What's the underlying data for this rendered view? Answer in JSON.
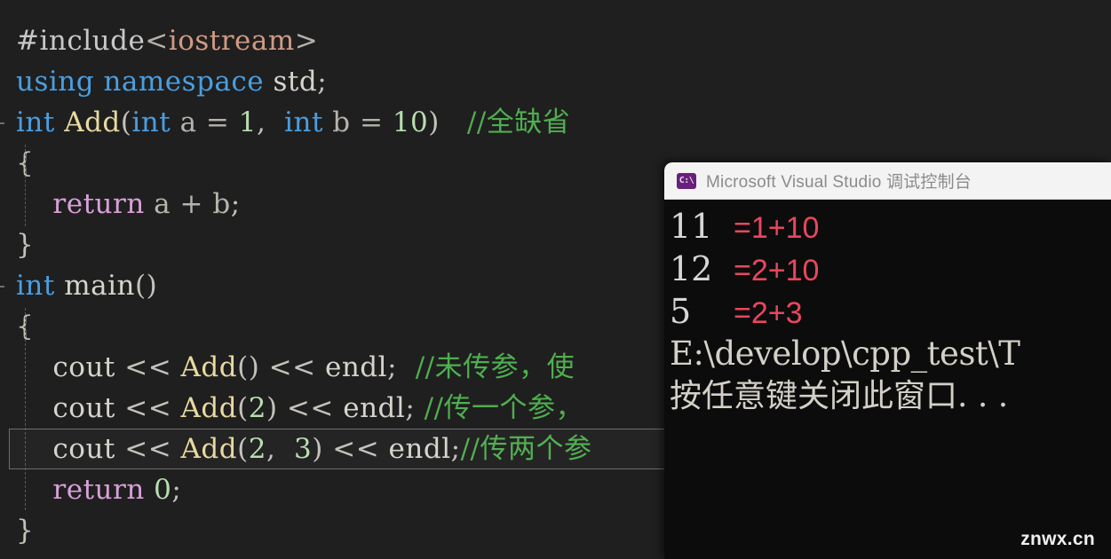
{
  "editor": {
    "background": "#1f1f1f",
    "lines": [
      {
        "indent": 0,
        "tokens": [
          {
            "t": "#include",
            "c": "t-pre"
          },
          {
            "t": "<",
            "c": "t-angle"
          },
          {
            "t": "iostream",
            "c": "t-header"
          },
          {
            "t": ">",
            "c": "t-angle"
          }
        ]
      },
      {
        "indent": 0,
        "tokens": [
          {
            "t": "using",
            "c": "t-kw"
          },
          {
            "t": " ",
            "c": "t-plain"
          },
          {
            "t": "namespace",
            "c": "t-kw"
          },
          {
            "t": " ",
            "c": "t-plain"
          },
          {
            "t": "std",
            "c": "t-plain"
          },
          {
            "t": ";",
            "c": "t-punct"
          }
        ]
      },
      {
        "indent": 0,
        "tokens": [
          {
            "t": "int",
            "c": "t-kw"
          },
          {
            "t": " ",
            "c": "t-plain"
          },
          {
            "t": "Add",
            "c": "t-func"
          },
          {
            "t": "(",
            "c": "t-punct"
          },
          {
            "t": "int",
            "c": "t-kw"
          },
          {
            "t": " ",
            "c": "t-plain"
          },
          {
            "t": "a",
            "c": "t-var"
          },
          {
            "t": " = ",
            "c": "t-var"
          },
          {
            "t": "1",
            "c": "t-num"
          },
          {
            "t": ",  ",
            "c": "t-punct"
          },
          {
            "t": "int",
            "c": "t-kw"
          },
          {
            "t": " ",
            "c": "t-plain"
          },
          {
            "t": "b",
            "c": "t-var"
          },
          {
            "t": " = ",
            "c": "t-var"
          },
          {
            "t": "10",
            "c": "t-num"
          },
          {
            "t": ")   ",
            "c": "t-punct"
          },
          {
            "t": "//全缺省",
            "c": "t-comment"
          }
        ]
      },
      {
        "indent": 0,
        "tokens": [
          {
            "t": "{",
            "c": "t-punct"
          }
        ]
      },
      {
        "indent": 1,
        "tokens": [
          {
            "t": "    ",
            "c": "t-plain"
          },
          {
            "t": "return",
            "c": "t-ctrl"
          },
          {
            "t": " ",
            "c": "t-plain"
          },
          {
            "t": "a",
            "c": "t-var"
          },
          {
            "t": " + ",
            "c": "t-var"
          },
          {
            "t": "b",
            "c": "t-var"
          },
          {
            "t": ";",
            "c": "t-punct"
          }
        ]
      },
      {
        "indent": 0,
        "tokens": [
          {
            "t": "}",
            "c": "t-punct"
          }
        ]
      },
      {
        "indent": 0,
        "tokens": [
          {
            "t": "int",
            "c": "t-kw"
          },
          {
            "t": " ",
            "c": "t-plain"
          },
          {
            "t": "main",
            "c": "t-plain"
          },
          {
            "t": "()",
            "c": "t-punct"
          }
        ]
      },
      {
        "indent": 0,
        "tokens": [
          {
            "t": "{",
            "c": "t-punct"
          }
        ]
      },
      {
        "indent": 1,
        "tokens": [
          {
            "t": "    ",
            "c": "t-plain"
          },
          {
            "t": "cout",
            "c": "t-plain"
          },
          {
            "t": " << ",
            "c": "t-punct"
          },
          {
            "t": "Add",
            "c": "t-func"
          },
          {
            "t": "()",
            "c": "t-punct"
          },
          {
            "t": " << ",
            "c": "t-punct"
          },
          {
            "t": "endl",
            "c": "t-plain"
          },
          {
            "t": ";  ",
            "c": "t-punct"
          },
          {
            "t": "//未传参，使",
            "c": "t-comment"
          }
        ]
      },
      {
        "indent": 1,
        "tokens": [
          {
            "t": "    ",
            "c": "t-plain"
          },
          {
            "t": "cout",
            "c": "t-plain"
          },
          {
            "t": " << ",
            "c": "t-punct"
          },
          {
            "t": "Add",
            "c": "t-func"
          },
          {
            "t": "(",
            "c": "t-punct"
          },
          {
            "t": "2",
            "c": "t-num"
          },
          {
            "t": ")",
            "c": "t-punct"
          },
          {
            "t": " << ",
            "c": "t-punct"
          },
          {
            "t": "endl",
            "c": "t-plain"
          },
          {
            "t": "; ",
            "c": "t-punct"
          },
          {
            "t": "//传一个参，",
            "c": "t-comment"
          }
        ]
      },
      {
        "indent": 1,
        "current": true,
        "tokens": [
          {
            "t": "    ",
            "c": "t-plain"
          },
          {
            "t": "cout",
            "c": "t-plain"
          },
          {
            "t": " << ",
            "c": "t-punct"
          },
          {
            "t": "Add",
            "c": "t-func"
          },
          {
            "t": "(",
            "c": "t-punct"
          },
          {
            "t": "2",
            "c": "t-num"
          },
          {
            "t": ",  ",
            "c": "t-punct"
          },
          {
            "t": "3",
            "c": "t-num"
          },
          {
            "t": ")",
            "c": "t-punct"
          },
          {
            "t": " << ",
            "c": "t-punct"
          },
          {
            "t": "endl",
            "c": "t-plain"
          },
          {
            "t": ";",
            "c": "t-punct"
          },
          {
            "t": "//传两个参",
            "c": "t-comment"
          }
        ]
      },
      {
        "indent": 1,
        "tokens": [
          {
            "t": "    ",
            "c": "t-plain"
          },
          {
            "t": "return",
            "c": "t-ctrl"
          },
          {
            "t": " ",
            "c": "t-plain"
          },
          {
            "t": "0",
            "c": "t-num"
          },
          {
            "t": ";",
            "c": "t-punct"
          }
        ]
      },
      {
        "indent": 0,
        "tokens": [
          {
            "t": "}",
            "c": "t-punct"
          }
        ]
      }
    ]
  },
  "console": {
    "icon": "visual-studio-console-icon",
    "icon_glyph": "C:\\",
    "title": "Microsoft Visual Studio 调试控制台",
    "background": "#0c0c0c",
    "titlebar_background": "#f3f3f3",
    "note_color": "#e8475e",
    "output_lines": [
      {
        "value": "11",
        "note": "=1+10"
      },
      {
        "value": "12",
        "note": "=2+10"
      },
      {
        "value": "5",
        "note": "=2+3"
      }
    ],
    "path_line": "E:\\develop\\cpp_test\\T",
    "prompt_line": "按任意键关闭此窗口. . ."
  },
  "watermark": "znwx.cn"
}
